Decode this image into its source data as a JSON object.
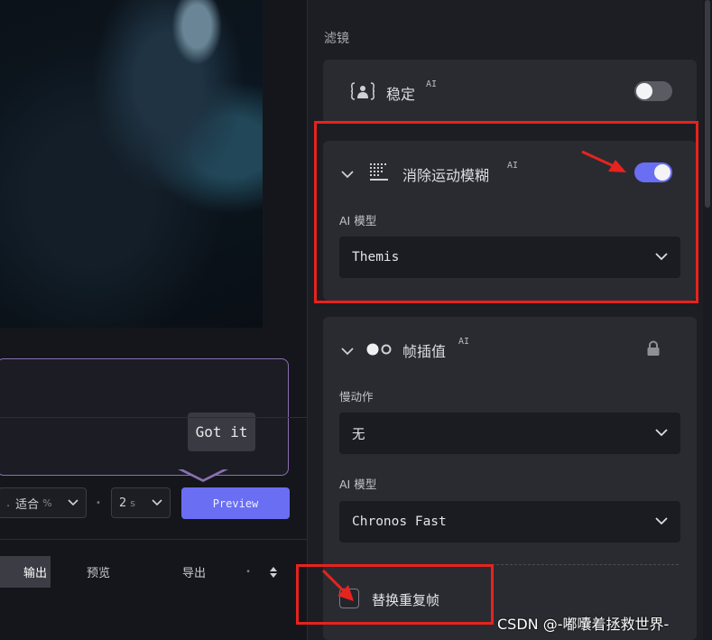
{
  "left_panel": {
    "tooltip": {
      "button_label": "Got it"
    },
    "controls": {
      "fit_select": "适合",
      "fit_unit": "%",
      "duration_select": "2",
      "duration_unit": "s",
      "preview_label": "Preview"
    },
    "tabs": [
      {
        "label": "输出",
        "active": true
      },
      {
        "label": "预览",
        "active": false
      },
      {
        "label": "导出",
        "active": false
      }
    ]
  },
  "filters": {
    "section_title": "滤镜",
    "ai_tag": "AI",
    "stabilize": {
      "label": "稳定",
      "enabled": false
    },
    "motion_deblur": {
      "label": "消除运动模糊",
      "enabled": true,
      "model_label": "AI 模型",
      "model_value": "Themis"
    },
    "frame_interpolation": {
      "label": "帧插值",
      "locked": true,
      "slowmo_label": "慢动作",
      "slowmo_value": "无",
      "model_label": "AI 模型",
      "model_value": "Chronos Fast"
    },
    "replace_duplicate": {
      "label": "替换重复帧",
      "checked": false
    }
  },
  "colors": {
    "accent": "#6a6ef3",
    "annotation_red": "#e6231e",
    "tooltip_border": "#8b6fb0"
  },
  "watermark": "CSDN @-嘟囔着拯救世界-"
}
